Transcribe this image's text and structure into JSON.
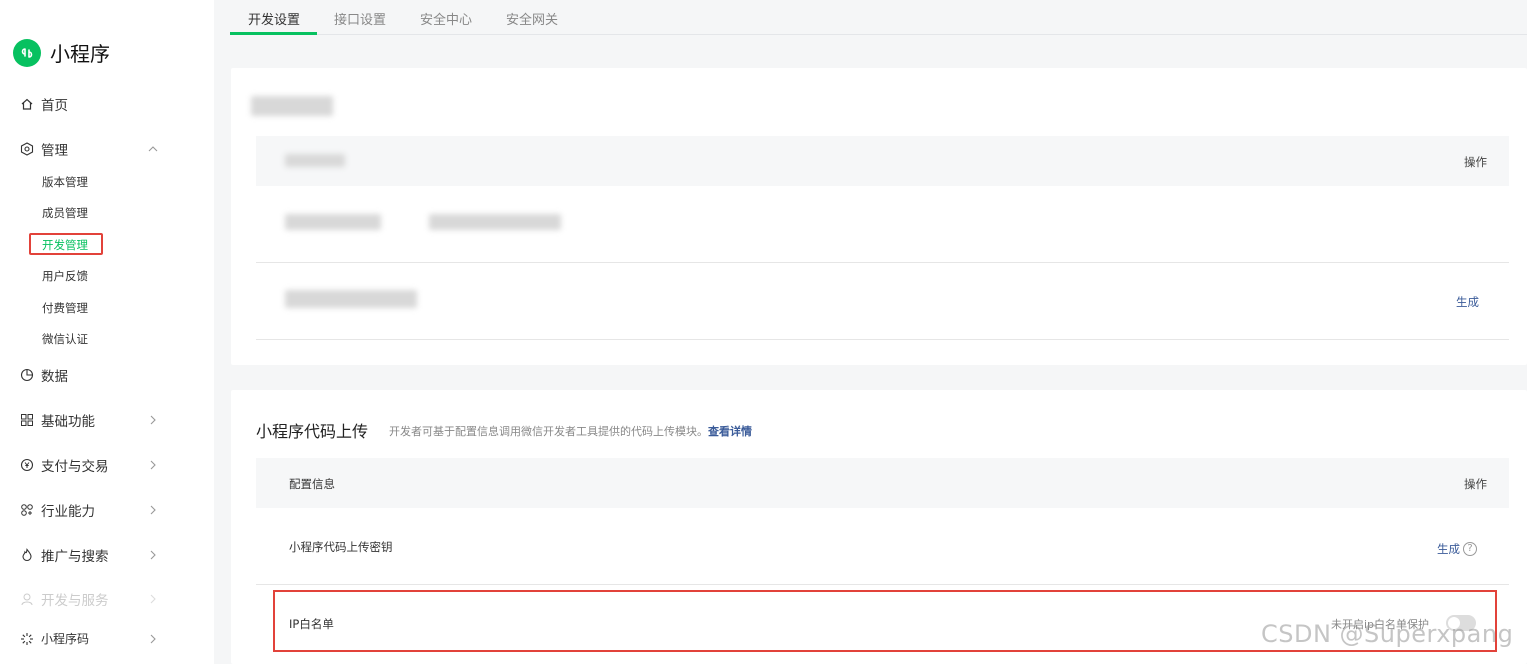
{
  "app": {
    "title": "小程序"
  },
  "sidebar": {
    "home": "首页",
    "manage": "管理",
    "manage_items": [
      "版本管理",
      "成员管理",
      "开发管理",
      "用户反馈",
      "付费管理",
      "微信认证"
    ],
    "data": "数据",
    "basic": "基础功能",
    "payment": "支付与交易",
    "industry": "行业能力",
    "promotion": "推广与搜索",
    "dev_service": "开发与服务",
    "qrcode": "小程序码"
  },
  "tabs": [
    "开发设置",
    "接口设置",
    "安全中心",
    "安全网关"
  ],
  "card1": {
    "op_header": "操作",
    "generate": "生成"
  },
  "card2": {
    "title": "小程序代码上传",
    "description": "开发者可基于配置信息调用微信开发者工具提供的代码上传模块。",
    "detail_link": "查看详情",
    "col_config": "配置信息",
    "col_op": "操作",
    "row1_label": "小程序代码上传密钥",
    "row1_action": "生成",
    "row2_label": "IP白名单",
    "row2_status": "未开启ip白名单保护",
    "row2_toggle_on": false
  },
  "watermark": "CSDN @Superxpang",
  "colors": {
    "brand": "#07c160",
    "highlight": "#e2423a",
    "link": "#3a5b99"
  }
}
